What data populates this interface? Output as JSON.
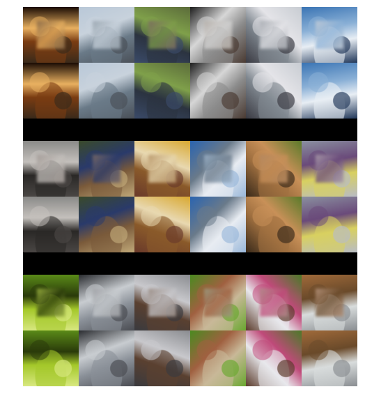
{
  "figure": {
    "description_visible_text": "",
    "blocks": [
      {
        "tiles": [
          {
            "icon": "candle-lamp",
            "palette": [
              "#1a0b04",
              "#7a3c12",
              "#e8b060",
              "#3a2a1a"
            ],
            "occluder": "#8a6a48"
          },
          {
            "icon": "lake-shore",
            "palette": [
              "#b9c8d8",
              "#6a7a88",
              "#c8d2dc",
              "#4a5058"
            ],
            "occluder": "#9aa6b0"
          },
          {
            "icon": "room-window",
            "palette": [
              "#5b6b3a",
              "#2b3340",
              "#7fa04a",
              "#3a4a68"
            ],
            "occluder": "#7b6a60"
          },
          {
            "icon": "person-laptop",
            "palette": [
              "#1e1e1e",
              "#8b8b8b",
              "#d6d6d6",
              "#4a3a32"
            ],
            "occluder": "#b6b0aa"
          },
          {
            "icon": "skateboarder",
            "palette": [
              "#c8ccd2",
              "#808890",
              "#e4e4e8",
              "#3a3a42"
            ],
            "occluder": "#a8acb2"
          },
          {
            "icon": "skier",
            "palette": [
              "#3a74b4",
              "#e8eef4",
              "#8ab0d6",
              "#22385a"
            ],
            "occluder": "#c0cad6"
          }
        ]
      },
      {
        "tiles": [
          {
            "icon": "pier-sunset",
            "palette": [
              "#8a8a88",
              "#2a2826",
              "#c4c0bc",
              "#4a4644"
            ],
            "occluder": "#a49c98"
          },
          {
            "icon": "woman-kitchen",
            "palette": [
              "#3a4a2a",
              "#7a5a3a",
              "#2a3a6a",
              "#c0a878"
            ],
            "occluder": "#7a6a66"
          },
          {
            "icon": "living-room",
            "palette": [
              "#d8a830",
              "#8a5a2a",
              "#e8d8b0",
              "#6a3a2a"
            ],
            "occluder": "#b8966a"
          },
          {
            "icon": "snow-hiker",
            "palette": [
              "#2a64b0",
              "#e8ecf2",
              "#6a7a8a",
              "#9ab8da"
            ],
            "occluder": "#9ab0c6"
          },
          {
            "icon": "bear",
            "palette": [
              "#5a7a2a",
              "#a07040",
              "#c89058",
              "#3a2a1a"
            ],
            "occluder": "#b48860"
          },
          {
            "icon": "train",
            "palette": [
              "#8a90a0",
              "#d8d060",
              "#6a4a7a",
              "#b8bcc4"
            ],
            "occluder": "#a89aa8"
          }
        ]
      },
      {
        "tiles": [
          {
            "icon": "green-apples",
            "palette": [
              "#5a8a18",
              "#a4c82a",
              "#2a3a0a",
              "#d8e880"
            ],
            "occluder": "#9ab040"
          },
          {
            "icon": "car-interior",
            "palette": [
              "#2a2c30",
              "#8a9098",
              "#c8ccd0",
              "#4a4c52"
            ],
            "occluder": "#a0a2a6"
          },
          {
            "icon": "dog-cabinet",
            "palette": [
              "#8a8c90",
              "#5a4030",
              "#c8c8cc",
              "#3a3a3e"
            ],
            "occluder": "#9a8c84"
          },
          {
            "icon": "sheep-field",
            "palette": [
              "#4a8a20",
              "#c8b898",
              "#a06040",
              "#6aa830"
            ],
            "occluder": "#9a9a80"
          },
          {
            "icon": "boy-dog",
            "palette": [
              "#4a7a28",
              "#e8e8ec",
              "#c04a7a",
              "#5a3a2a"
            ],
            "occluder": "#b08a88"
          },
          {
            "icon": "hallway-door",
            "palette": [
              "#a06a3a",
              "#d8dcdc",
              "#6a4a2a",
              "#8a8e92"
            ],
            "occluder": "#b4927a"
          }
        ]
      }
    ]
  }
}
